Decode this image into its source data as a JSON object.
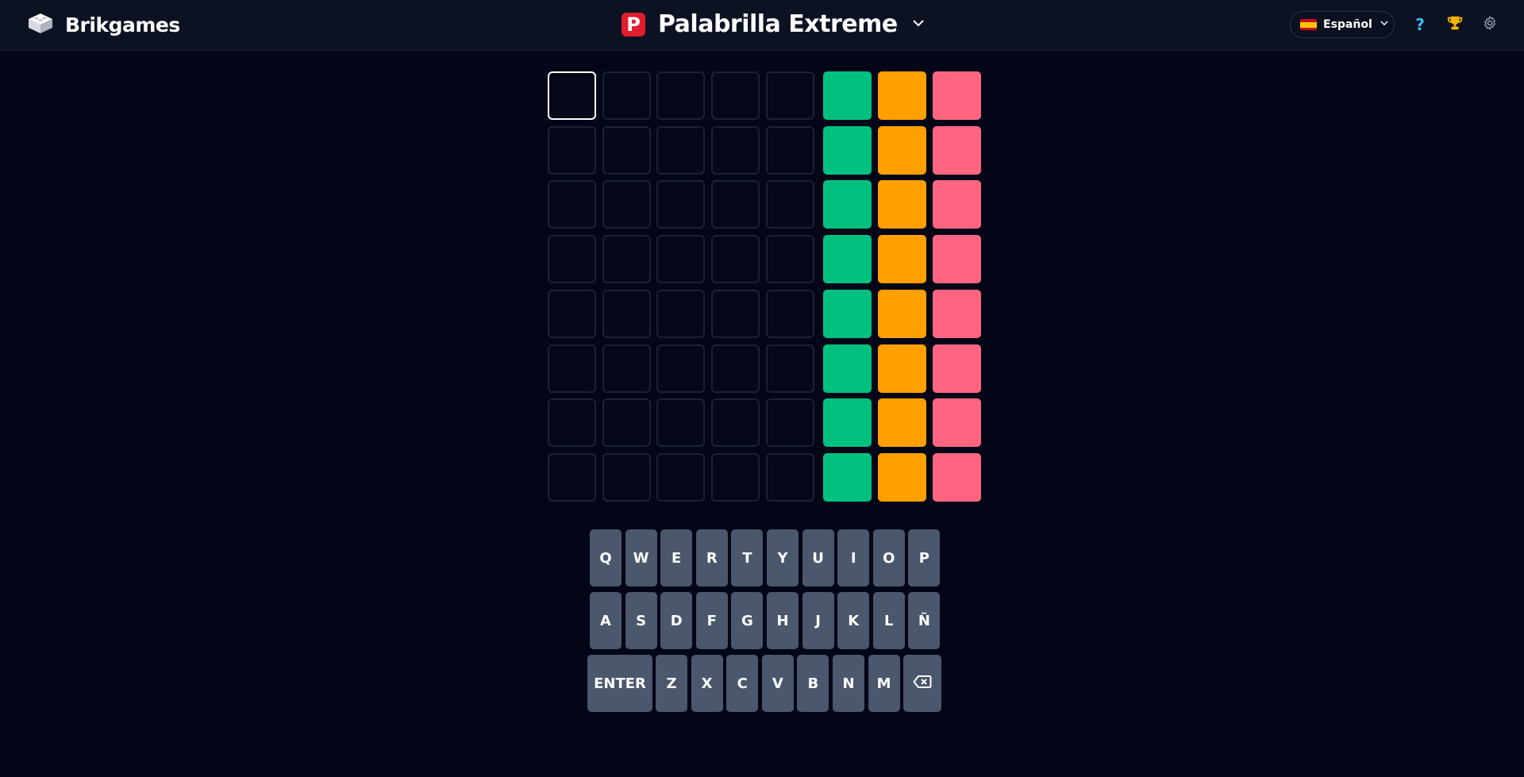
{
  "header": {
    "brand_name": "Brikgames",
    "game_logo_letter": "P",
    "game_title": "Palabrilla Extreme",
    "language": "Español"
  },
  "board": {
    "rows": 8,
    "letter_columns": 5,
    "active_cell": [
      0,
      0
    ],
    "hint_colors": [
      "#00c080",
      "#ff9f00",
      "#ff6580"
    ]
  },
  "keyboard": {
    "row1": [
      "Q",
      "W",
      "E",
      "R",
      "T",
      "Y",
      "U",
      "I",
      "O",
      "P"
    ],
    "row2": [
      "A",
      "S",
      "D",
      "F",
      "G",
      "H",
      "J",
      "K",
      "L",
      "Ñ"
    ],
    "row3": [
      "ENTER",
      "Z",
      "X",
      "C",
      "V",
      "B",
      "N",
      "M"
    ],
    "backspace_icon": "backspace-icon"
  },
  "colors": {
    "background": "#030617",
    "topbar": "#0d1223",
    "key": "#4a576c"
  }
}
